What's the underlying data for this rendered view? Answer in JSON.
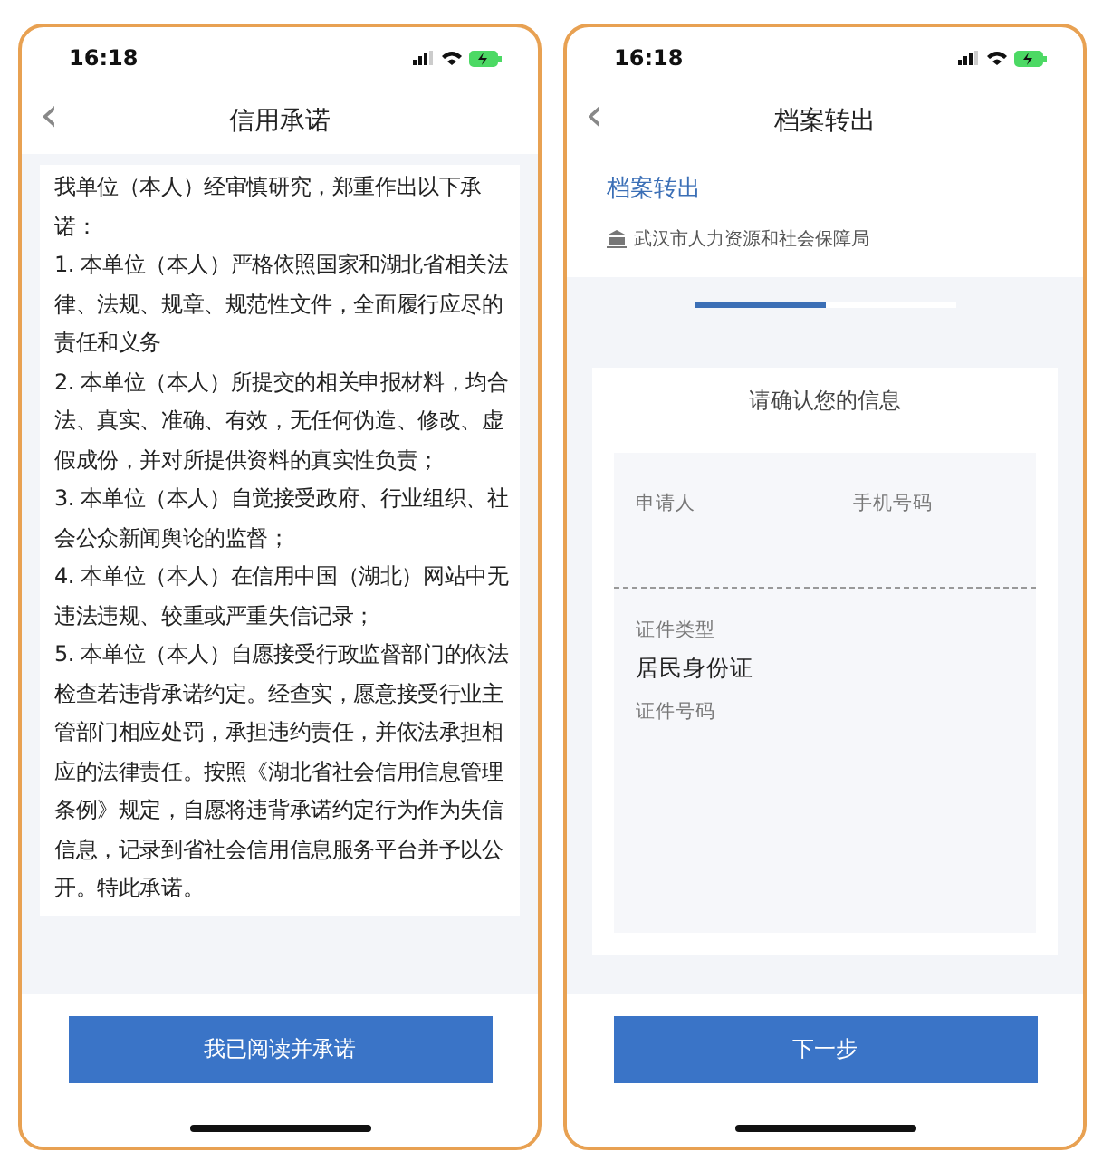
{
  "screens": [
    {
      "kind": "commitment",
      "status_bar": {
        "time": "16:18"
      },
      "nav": {
        "back": "‹",
        "title": "信用承诺"
      },
      "paragraphs": [
        "我单位（本人）经审慎研究，郑重作出以下承诺：",
        "1. 本单位（本人）严格依照国家和湖北省相关法律、法规、规章、规范性文件，全面履行应尽的责任和义务",
        "2. 本单位（本人）所提交的相关申报材料，均合法、真实、准确、有效，无任何伪造、修改、虚假成份，并对所提供资料的真实性负责；",
        "3. 本单位（本人）自觉接受政府、行业组织、社会公众新闻舆论的监督；",
        "4. 本单位（本人）在信用中国（湖北）网站中无违法违规、较重或严重失信记录；",
        "5. 本单位（本人）自愿接受行政监督部门的依法检查若违背承诺约定。经查实，愿意接受行业主管部门相应处罚，承担违约责任，并依法承担相应的法律责任。按照《湖北省社会信用信息管理条例》规定，自愿将违背承诺约定行为作为失信信息，记录到省社会信用信息服务平台并予以公开。特此承诺。"
      ],
      "button": "我已阅读并承诺"
    },
    {
      "kind": "transfer",
      "status_bar": {
        "time": "16:18"
      },
      "nav": {
        "back": "‹",
        "title": "档案转出"
      },
      "service": {
        "name": "档案转出",
        "agency": "武汉市人力资源和社会保障局"
      },
      "progress": {
        "level": 0.5
      },
      "card": {
        "heading": "请确认您的信息",
        "top_fields": [
          {
            "label": "申请人"
          },
          {
            "label": "手机号码"
          }
        ],
        "id_type_label": "证件类型",
        "id_type_value": "居民身份证",
        "id_number_label": "证件号码"
      },
      "button": "下一步"
    }
  ]
}
